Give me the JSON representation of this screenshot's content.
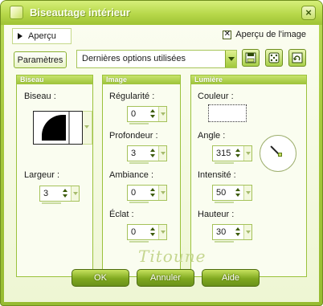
{
  "window": {
    "title": "Biseautage intérieur"
  },
  "preview": {
    "toggle_label": "Aperçu",
    "image_preview_label": "Aperçu de l'image",
    "image_preview_checked": true
  },
  "params": {
    "button_label": "Paramètres",
    "selected": "Dernières options utilisées"
  },
  "bevel_group": {
    "title": "Biseau",
    "bevel_label": "Biseau :",
    "width_label": "Largeur :",
    "width_value": "3"
  },
  "image_group": {
    "title": "Image",
    "smoothness_label": "Régularité :",
    "smoothness_value": "0",
    "depth_label": "Profondeur :",
    "depth_value": "3",
    "ambience_label": "Ambiance :",
    "ambience_value": "0",
    "shininess_label": "Éclat :",
    "shininess_value": "0"
  },
  "light_group": {
    "title": "Lumière",
    "color_label": "Couleur :",
    "color_value": "#ffffff",
    "angle_label": "Angle :",
    "angle_value": "315",
    "intensity_label": "Intensité :",
    "intensity_value": "50",
    "elevation_label": "Hauteur :",
    "elevation_value": "30"
  },
  "buttons": {
    "ok": "OK",
    "cancel": "Annuler",
    "help": "Aide"
  },
  "signature": "Titoune",
  "icons": {
    "close": "close-icon",
    "save": "save-icon",
    "random": "dice-icon",
    "reset": "reset-icon"
  },
  "theme": {
    "accent": "#a6c93d",
    "accent_dark": "#6f8d1d",
    "button": "#7fa81f"
  }
}
